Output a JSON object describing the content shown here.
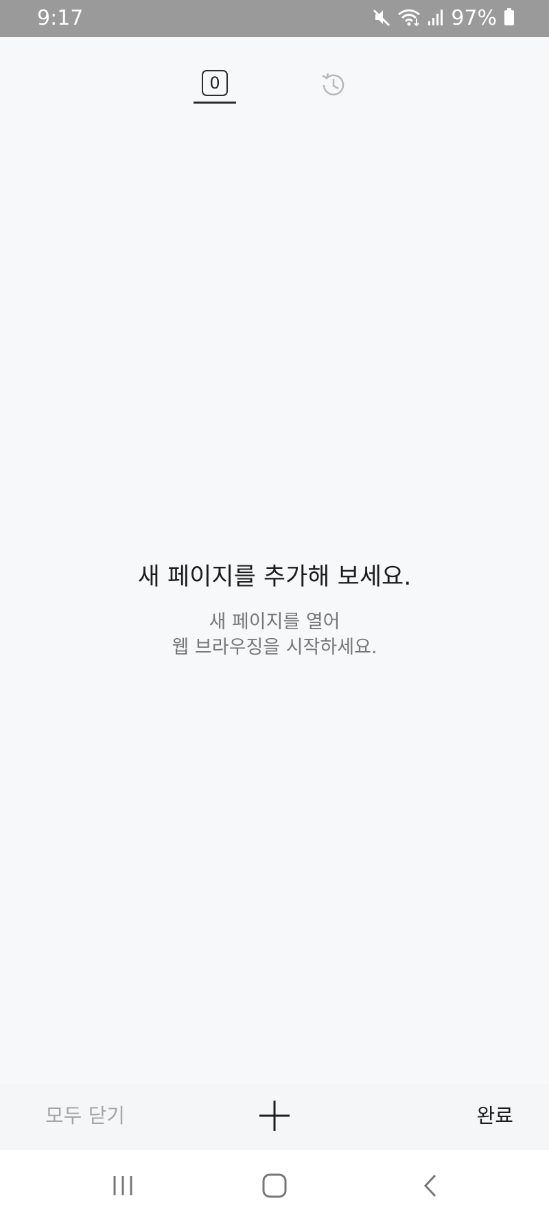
{
  "status_bar": {
    "time": "9:17",
    "battery": "97%",
    "icons": [
      "mute-icon",
      "wifi-icon",
      "signal-icon",
      "battery-icon"
    ]
  },
  "tabs": {
    "open_count": "0",
    "items": [
      "tabs-count-icon",
      "history-icon"
    ]
  },
  "empty_state": {
    "title": "새 페이지를 추가해 보세요.",
    "subtitle_line1": "새 페이지를 열어",
    "subtitle_line2": "웹 브라우징을 시작하세요."
  },
  "toolbar": {
    "close_all_label": "모두 닫기",
    "add_icon": "plus-icon",
    "done_label": "완료"
  },
  "nav_bar": {
    "icons": [
      "recent-apps-icon",
      "home-icon",
      "back-icon"
    ]
  },
  "colors": {
    "background": "#f7f8fa",
    "status_bar": "#9a9a9a",
    "text_primary": "#1d1d1d",
    "text_secondary": "#777777",
    "text_disabled": "#a5a5a5"
  }
}
